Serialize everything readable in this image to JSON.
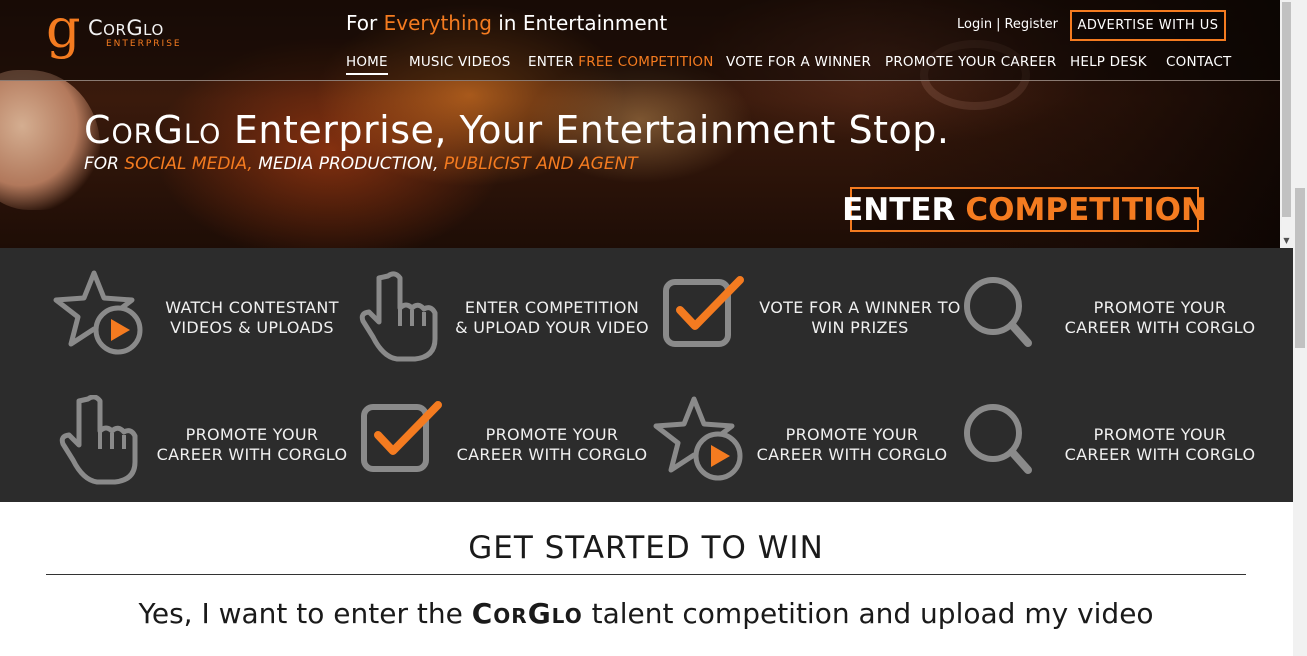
{
  "header": {
    "logo": {
      "letter": "g",
      "brand": "CorGlo",
      "sub": "ENTERPRISE"
    },
    "tagline": {
      "pre": "For ",
      "highlight": "Everything",
      "post": " in Entertainment"
    },
    "login": "Login",
    "separator": "|",
    "register": "Register",
    "advertise": "ADVERTISE WITH US",
    "nav": [
      {
        "label": "HOME",
        "highlight": ""
      },
      {
        "label": "MUSIC VIDEOS",
        "highlight": ""
      },
      {
        "label": "ENTER ",
        "highlight": "FREE COMPETITION"
      },
      {
        "label": "VOTE FOR A WINNER",
        "highlight": ""
      },
      {
        "label": "PROMOTE YOUR CAREER",
        "highlight": ""
      },
      {
        "label": "HELP DESK",
        "highlight": ""
      },
      {
        "label": "CONTACT",
        "highlight": ""
      }
    ]
  },
  "hero": {
    "brandword": "CorGlo",
    "title_rest": " Enterprise, Your Entertainment Stop.",
    "sub": {
      "p1": "FOR ",
      "h1": "SOCIAL MEDIA,",
      "p2": " MEDIA PRODUCTION, ",
      "h2": "PUBLICIST AND AGENT"
    },
    "cta": {
      "white": "ENTER",
      "orange": "COMPETITION"
    }
  },
  "features": [
    {
      "icon": "star-play-icon",
      "line1": "WATCH CONTESTANT",
      "line2": "VIDEOS & UPLOADS"
    },
    {
      "icon": "pointer-hand-icon",
      "line1": "ENTER COMPETITION",
      "line2": "& UPLOAD YOUR VIDEO"
    },
    {
      "icon": "checkbox-icon",
      "line1": "VOTE FOR A WINNER TO",
      "line2": "WIN PRIZES"
    },
    {
      "icon": "search-icon",
      "line1": "PROMOTE YOUR",
      "line2": "CAREER WITH CORGLO"
    },
    {
      "icon": "pointer-hand-icon",
      "line1": "PROMOTE YOUR",
      "line2": "CAREER WITH CORGLO"
    },
    {
      "icon": "checkbox-icon",
      "line1": "PROMOTE YOUR",
      "line2": "CAREER WITH CORGLO"
    },
    {
      "icon": "star-play-icon",
      "line1": "PROMOTE YOUR",
      "line2": "CAREER WITH CORGLO"
    },
    {
      "icon": "search-icon",
      "line1": "PROMOTE YOUR",
      "line2": "CAREER WITH CORGLO"
    }
  ],
  "get_started": {
    "title": "GET STARTED TO WIN",
    "text_pre": "Yes, I want to enter the ",
    "brandword": "CorGlo",
    "text_post": " talent competition and upload my video"
  },
  "colors": {
    "accent": "#f47b20",
    "band": "#2c2c2c",
    "icon_gray": "#8a8a8a"
  }
}
